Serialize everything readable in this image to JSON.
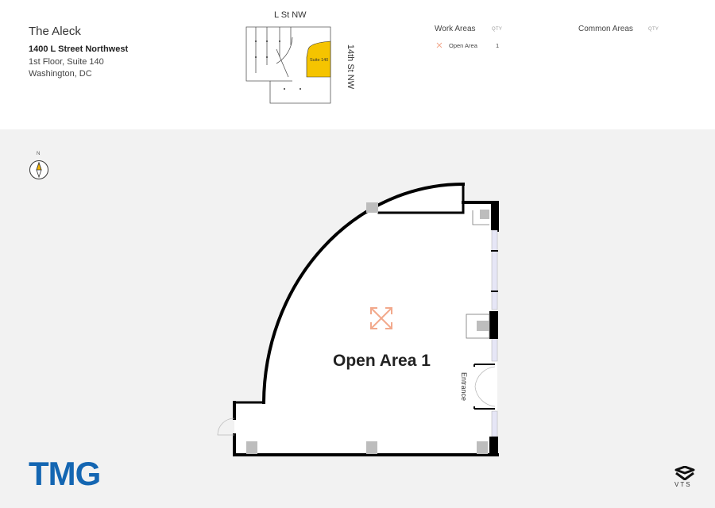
{
  "building": {
    "name": "The Aleck",
    "address": "1400 L Street Northwest",
    "floor_suite": "1st Floor, Suite 140",
    "city": "Washington, DC"
  },
  "thumbnail": {
    "street_top": "L St NW",
    "street_right": "14th St NW",
    "suite_label": "Suite 140",
    "highlight_color": "#f5c400"
  },
  "legend": {
    "work_areas": {
      "title": "Work Areas",
      "qty_header": "QTY",
      "items": [
        {
          "icon": "open-area-arrows-icon",
          "label": "Open Area",
          "qty": "1"
        }
      ]
    },
    "common_areas": {
      "title": "Common Areas",
      "qty_header": "QTY"
    }
  },
  "compass": {
    "label": "N"
  },
  "plan": {
    "area_label": "Open Area 1",
    "entrance_label": "Entrance",
    "area_icon": "open-area-arrows-icon",
    "icon_color": "#f2a98c"
  },
  "branding": {
    "logo": "TMG",
    "logo_color": "#1466b2",
    "vts": "VTS"
  }
}
